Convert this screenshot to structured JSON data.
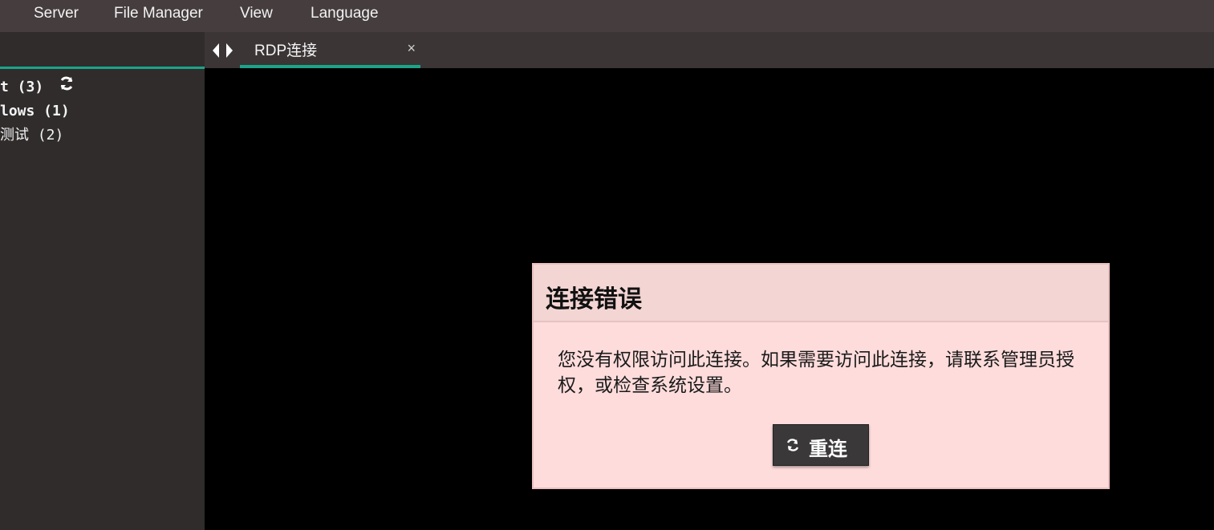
{
  "menubar": {
    "items": [
      "Server",
      "File Manager",
      "View",
      "Language"
    ]
  },
  "sidebar": {
    "tree": [
      {
        "label": "t (3)",
        "bold": true,
        "has_refresh": true
      },
      {
        "label": "lows (1)",
        "bold": true
      },
      {
        "label": "测试 (2)",
        "bold": false
      }
    ],
    "refresh_icon": "refresh-icon"
  },
  "tabs": {
    "active": {
      "label": "RDP连接",
      "close": "×"
    }
  },
  "dialog": {
    "title": "连接错误",
    "message": "您没有权限访问此连接。如果需要访问此连接，请联系管理员授权，或检查系统设置。",
    "reconnect_label": "重连"
  },
  "colors": {
    "menubar": "#453d3e",
    "sidebar": "#302c2c",
    "accent": "#1aa589",
    "dialog_bg": "#ffdcdc"
  }
}
